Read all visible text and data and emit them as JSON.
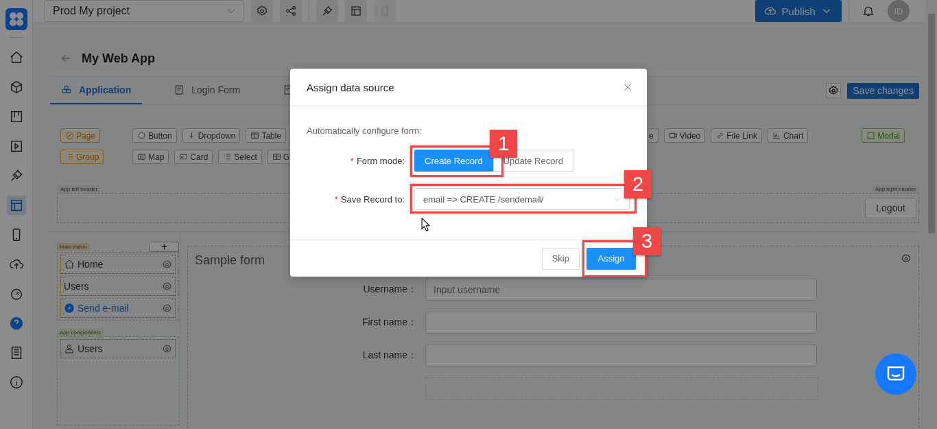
{
  "topbar": {
    "project": "Prod My project",
    "tools": [
      {
        "disabled": false
      },
      {
        "disabled": false
      },
      {
        "disabled": false
      },
      {
        "disabled": false
      },
      {
        "disabled": true
      }
    ],
    "publish": "Publish",
    "avatar": "ID"
  },
  "rail": [
    {
      "selected": false
    },
    {
      "selected": false
    },
    {
      "selected": false
    },
    {
      "selected": false
    },
    {
      "selected": false
    },
    {
      "selected": true
    },
    {
      "selected": false
    },
    {
      "selected": false
    },
    {
      "selected": false
    },
    {
      "selected": false
    },
    {
      "selected": false
    },
    {
      "selected": false
    }
  ],
  "page": {
    "title": "My Web App",
    "tabs": [
      {
        "label": "Application",
        "selected": true
      },
      {
        "label": "Login Form",
        "selected": false
      },
      {
        "selected": false
      }
    ],
    "save": "Save changes"
  },
  "palette": {
    "left": [
      "Page",
      "Group"
    ],
    "row1": [
      "Button",
      "Dropdown",
      "Table",
      "e",
      "Video",
      "File Link",
      "Chart"
    ],
    "row2": [
      "Map",
      "Card",
      "Select",
      "G"
    ],
    "modal": "Modal"
  },
  "app": {
    "left_header": "App left header",
    "right_header": "App right header",
    "logout": "Logout",
    "main_menu": "Main menu",
    "menu": [
      {
        "label": "Home",
        "link": false
      },
      {
        "label": "Users",
        "link": false
      },
      {
        "label": "Send e-mail",
        "link": true
      }
    ],
    "components_label": "App components",
    "components": [
      "Users"
    ]
  },
  "form": {
    "title": "Sample form",
    "fields": [
      {
        "label": "Username：",
        "placeholder": "Input username"
      },
      {
        "label": "First name："
      },
      {
        "label": "Last name："
      }
    ]
  },
  "dialog": {
    "title": "Assign data source",
    "intro": "Automatically configure form:",
    "form_mode": {
      "mark": "*",
      "label": "Form mode:"
    },
    "modes": [
      {
        "label": "Create Record",
        "selected": true
      },
      {
        "label": "Update Record",
        "selected": false
      }
    ],
    "save_to_field": {
      "mark": "*",
      "label": "Save Record to:"
    },
    "save_to": "email => CREATE /sendemail/",
    "skip": "Skip",
    "assign": "Assign"
  },
  "annotations": [
    {
      "number": "1"
    },
    {
      "number": "2"
    },
    {
      "number": "3"
    }
  ]
}
